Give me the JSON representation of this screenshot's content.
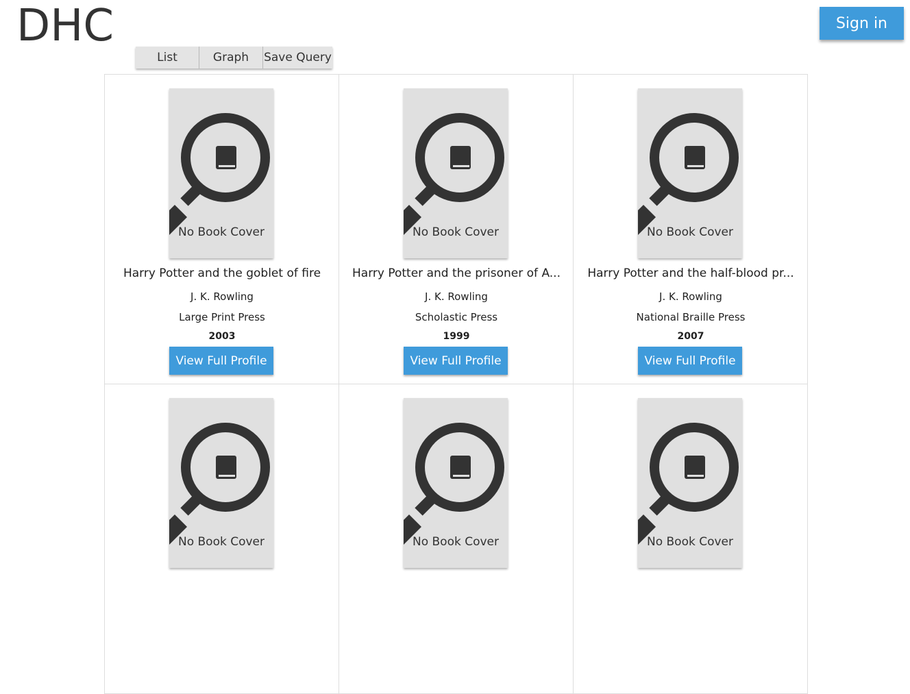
{
  "header": {
    "app_title": "DHC",
    "sign_in_label": "Sign in"
  },
  "view_tabs": {
    "list_label": "List",
    "graph_label": "Graph",
    "save_query_label": "Save Query"
  },
  "results": [
    {
      "cover_label": "No Book Cover",
      "title": "Harry Potter and the goblet of fire",
      "author": "J. K. Rowling",
      "publisher": "Large Print Press",
      "year": "2003",
      "action_label": "View Full Profile"
    },
    {
      "cover_label": "No Book Cover",
      "title": "Harry Potter and the prisoner of A...",
      "author": "J. K. Rowling",
      "publisher": "Scholastic Press",
      "year": "1999",
      "action_label": "View Full Profile"
    },
    {
      "cover_label": "No Book Cover",
      "title": "Harry Potter and the half-blood pr...",
      "author": "J. K. Rowling",
      "publisher": "National Braille Press",
      "year": "2007",
      "action_label": "View Full Profile"
    },
    {
      "cover_label": "No Book Cover"
    },
    {
      "cover_label": "No Book Cover"
    },
    {
      "cover_label": "No Book Cover"
    }
  ],
  "colors": {
    "accent": "#3f9bdb",
    "cover_bg": "#e0e0e0",
    "icon": "#333333"
  },
  "icons": {
    "cover_icon": "magnifier-book-icon"
  }
}
